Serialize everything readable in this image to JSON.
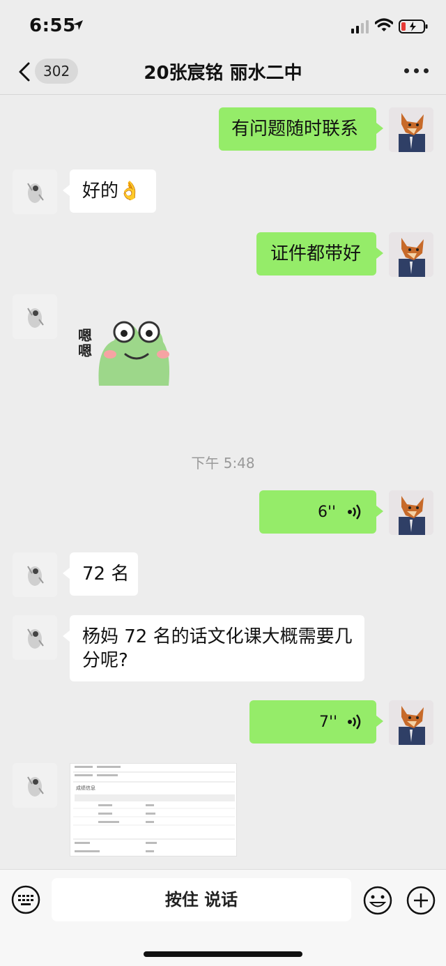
{
  "status_bar": {
    "time": "6:55"
  },
  "nav": {
    "badge": "302",
    "title": "20张宸铭 丽水二中"
  },
  "messages": [
    {
      "side": "right",
      "type": "text",
      "text": "有问题随时联系"
    },
    {
      "side": "left",
      "type": "text",
      "text": "好的👌"
    },
    {
      "side": "right",
      "type": "text",
      "text": "证件都带好"
    },
    {
      "side": "left",
      "type": "sticker",
      "text": "嗯嗯"
    },
    {
      "type": "timestamp",
      "text": "下午 5:48"
    },
    {
      "side": "right",
      "type": "voice",
      "duration": "6''"
    },
    {
      "side": "left",
      "type": "text",
      "text": "72 名"
    },
    {
      "side": "left",
      "type": "text",
      "line1": "杨妈 72 名的话文化课大概需要几",
      "line2": "分呢?"
    },
    {
      "side": "right",
      "type": "voice",
      "duration": "7''"
    },
    {
      "side": "left",
      "type": "image",
      "text": "成绩信息"
    }
  ],
  "input_bar": {
    "hold_to_talk": "按住 说话"
  },
  "colors": {
    "self_bubble": "#95ec69",
    "other_bubble": "#ffffff",
    "background": "#ededed"
  },
  "icons": [
    "location-arrow-icon",
    "signal-icon",
    "wifi-icon",
    "battery-icon",
    "back-chevron-icon",
    "more-icon",
    "voice-wave-icon",
    "keyboard-icon",
    "emoji-icon",
    "plus-icon"
  ]
}
